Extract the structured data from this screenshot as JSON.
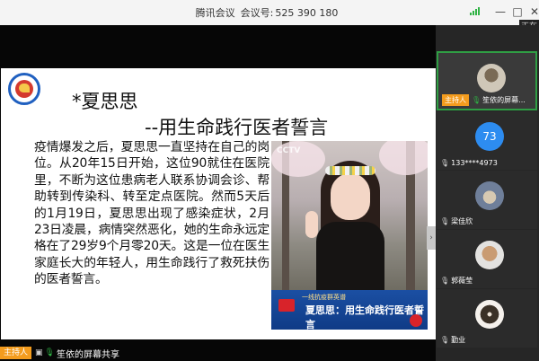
{
  "window": {
    "app_name": "腾讯会议",
    "meeting_label": "会议号:",
    "meeting_id": "525 390 180",
    "controls": {
      "minimize": "—",
      "maximize": "□",
      "close": "✕"
    },
    "corner_badge": "正在"
  },
  "slide": {
    "title_line1": "*夏思思",
    "title_line2": "--用生命践行医者誓言",
    "body": "疫情爆发之后，夏思思一直坚持在自己的岗位。从20年15日开始，这位90就住在医院里，不断为这位患病老人联系协调会诊、帮助转到传染科、转至定点医院。然而5天后的1月19日，夏思思出现了感染症状，2月23日凌晨，病情突然恶化，她的生命永远定格在了29岁9个月零20天。这是一位在医生家庭长大的年轻人，用生命践行了救死扶伤的医者誓言。",
    "photo_watermark": "CCTV",
    "caption_top": "一线抗疫群英谱",
    "caption_main": "夏思思：用生命践行医者誓言"
  },
  "presenter_bar": {
    "host_tag": "主持人",
    "name": "笙依的屏幕共享"
  },
  "participants": [
    {
      "name": "笙依的屏幕...",
      "host_tag": "主持人",
      "avatar": "photo-avatar",
      "mic": "on",
      "active": true
    },
    {
      "name": "133****4973",
      "avatar_text": "73",
      "avatar": "number-avatar",
      "mic": "off"
    },
    {
      "name": "梁佳欣",
      "avatar": "photo-avatar",
      "mic": "off"
    },
    {
      "name": "郭薇莹",
      "avatar": "photo-avatar",
      "mic": "off"
    },
    {
      "name": "勤业",
      "avatar": "photo-avatar",
      "mic": "off"
    }
  ],
  "colors": {
    "host_tag": "#f39c1e",
    "active_border": "#2f9e44",
    "mic_on": "#2fb344",
    "number_avatar": "#2d8cf0",
    "caption_bg": "#1b4fa3"
  }
}
